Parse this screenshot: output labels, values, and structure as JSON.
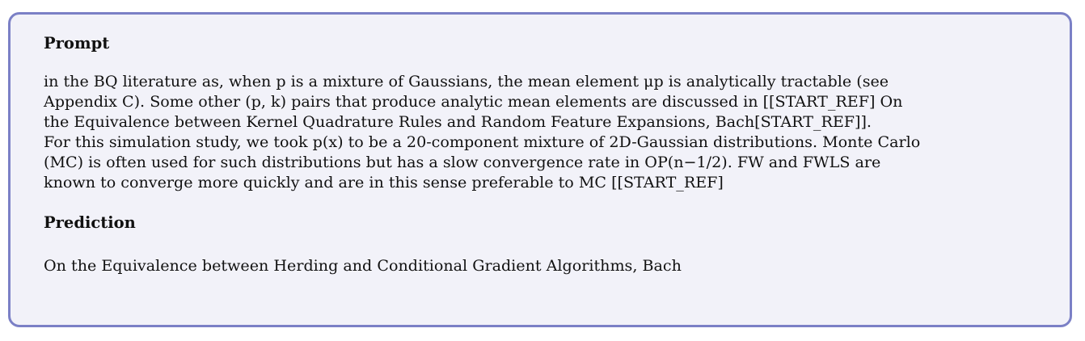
{
  "prompt": {
    "heading": "Prompt",
    "lines": [
      "in the BQ literature as, when p is a mixture of Gaussians, the mean element μp is analytically tractable (see",
      "Appendix C). Some other (p, k) pairs that produce analytic mean elements are discussed in [[START_REF] On",
      "the Equivalence between Kernel Quadrature Rules and Random Feature Expansions, Bach[START_REF]].",
      "For this simulation study, we took p(x) to be a 20-component mixture of 2D-Gaussian distributions. Monte Carlo",
      "(MC) is often used for such distributions but has a slow convergence rate in OP(n−1/2). FW and FWLS are",
      "known to converge more quickly and are in this sense preferable to MC [[START_REF]"
    ]
  },
  "prediction": {
    "heading": "Prediction",
    "text": "On the Equivalence between Herding and Conditional Gradient Algorithms, Bach"
  }
}
